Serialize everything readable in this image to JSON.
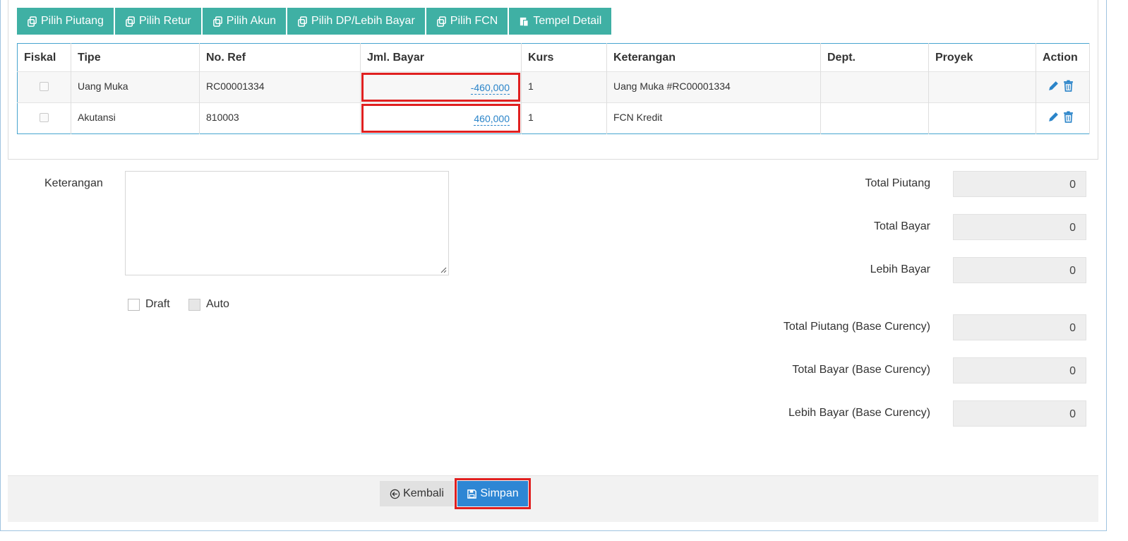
{
  "toolbar": {
    "buttons": [
      {
        "label": "Pilih Piutang",
        "icon": "copy-icon"
      },
      {
        "label": "Pilih Retur",
        "icon": "copy-icon"
      },
      {
        "label": "Pilih Akun",
        "icon": "copy-icon"
      },
      {
        "label": "Pilih DP/Lebih Bayar",
        "icon": "copy-icon"
      },
      {
        "label": "Pilih FCN",
        "icon": "copy-icon"
      },
      {
        "label": "Tempel Detail",
        "icon": "paste-icon"
      }
    ]
  },
  "table": {
    "headers": [
      "Fiskal",
      "Tipe",
      "No. Ref",
      "Jml. Bayar",
      "Kurs",
      "Keterangan",
      "Dept.",
      "Proyek",
      "Action"
    ],
    "rows": [
      {
        "fiskal": false,
        "tipe": "Uang Muka",
        "no_ref": "RC00001334",
        "jml_bayar": "-460,000",
        "kurs": "1",
        "keterangan": "Uang Muka #RC00001334",
        "dept": "",
        "proyek": ""
      },
      {
        "fiskal": false,
        "tipe": "Akutansi",
        "no_ref": "810003",
        "jml_bayar": "460,000",
        "kurs": "1",
        "keterangan": "FCN Kredit",
        "dept": "",
        "proyek": ""
      }
    ]
  },
  "form": {
    "keterangan_label": "Keterangan",
    "keterangan_value": "",
    "draft_label": "Draft",
    "auto_label": "Auto"
  },
  "summary": [
    {
      "label": "Total Piutang",
      "value": "0"
    },
    {
      "label": "Total Bayar",
      "value": "0"
    },
    {
      "label": "Lebih Bayar",
      "value": "0"
    },
    {
      "label": "Total Piutang (Base Curency)",
      "value": "0"
    },
    {
      "label": "Total Bayar (Base Curency)",
      "value": "0"
    },
    {
      "label": "Lebih Bayar (Base Curency)",
      "value": "0"
    }
  ],
  "footer": {
    "back_label": "Kembali",
    "save_label": "Simpan"
  },
  "colors": {
    "toolbar_button": "#3fb0a4",
    "save_button": "#2e86d4",
    "highlight": "#e02020",
    "link": "#2a84c9"
  }
}
